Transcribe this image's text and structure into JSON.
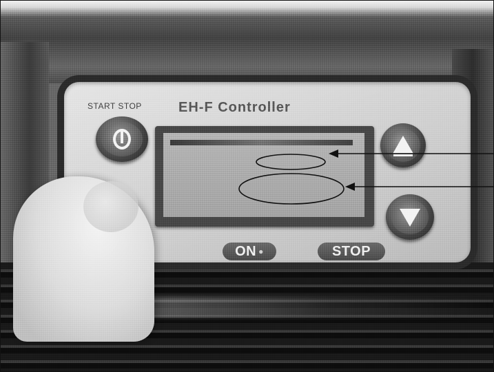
{
  "photo": {
    "title": "EH-F Controller",
    "start_stop_label": "START  STOP",
    "on_label": "ON",
    "stop_label": "STOP"
  },
  "icons": [
    "power-icon",
    "up-arrow-icon",
    "down-arrow-icon"
  ]
}
